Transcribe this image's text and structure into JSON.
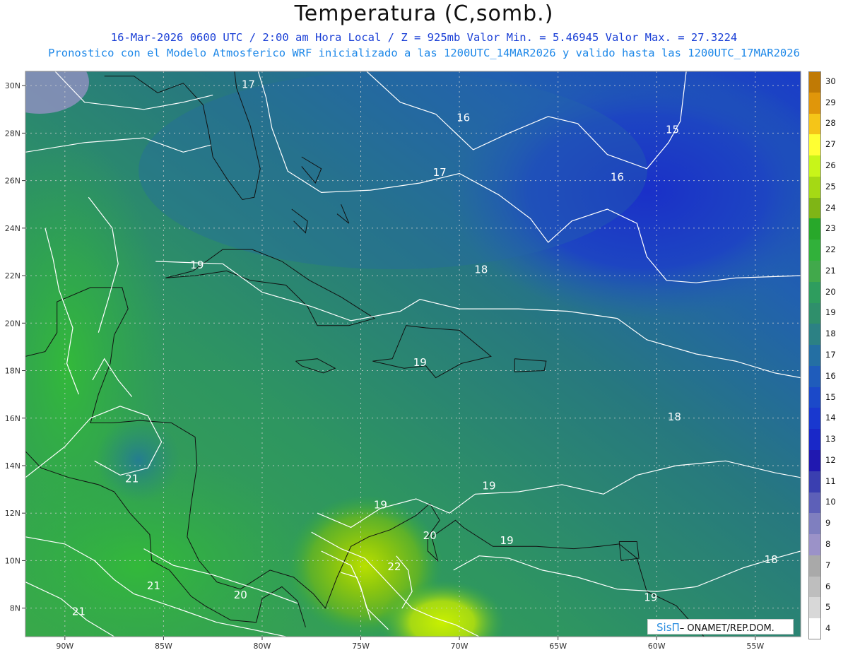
{
  "header": {
    "title": "Temperatura (C,somb.)",
    "line1": "16-Mar-2026  0600 UTC / 2:00 am Hora Local / Z = 925mb    Valor Min. = 5.46945  Valor Max. = 27.3224",
    "line2": "Pronostico con el Modelo Atmosferico WRF inicializado a las 1200UTC_14MAR2026 y valido hasta las  1200UTC_17MAR2026"
  },
  "map": {
    "lon_range": [
      -92.0,
      -52.7
    ],
    "lat_range": [
      6.8,
      30.6
    ],
    "lon_ticks": [
      {
        "value": -90,
        "label": "90W"
      },
      {
        "value": -85,
        "label": "85W"
      },
      {
        "value": -80,
        "label": "80W"
      },
      {
        "value": -75,
        "label": "75W"
      },
      {
        "value": -70,
        "label": "70W"
      },
      {
        "value": -65,
        "label": "65W"
      },
      {
        "value": -60,
        "label": "60W"
      },
      {
        "value": -55,
        "label": "55W"
      }
    ],
    "lat_ticks": [
      {
        "value": 30,
        "label": "30N"
      },
      {
        "value": 28,
        "label": "28N"
      },
      {
        "value": 26,
        "label": "26N"
      },
      {
        "value": 24,
        "label": "24N"
      },
      {
        "value": 22,
        "label": "22N"
      },
      {
        "value": 20,
        "label": "20N"
      },
      {
        "value": 18,
        "label": "18N"
      },
      {
        "value": 16,
        "label": "16N"
      },
      {
        "value": 14,
        "label": "14N"
      },
      {
        "value": 12,
        "label": "12N"
      },
      {
        "value": 10,
        "label": "10N"
      },
      {
        "value": 8,
        "label": "8N"
      }
    ],
    "contour_labels": [
      {
        "text": "17",
        "lon": -80.7,
        "lat": 29.9
      },
      {
        "text": "16",
        "lon": -69.8,
        "lat": 28.5
      },
      {
        "text": "15",
        "lon": -59.2,
        "lat": 28.0
      },
      {
        "text": "17",
        "lon": -71.0,
        "lat": 26.2
      },
      {
        "text": "16",
        "lon": -62.0,
        "lat": 26.0
      },
      {
        "text": "19",
        "lon": -83.3,
        "lat": 22.3
      },
      {
        "text": "18",
        "lon": -68.9,
        "lat": 22.1
      },
      {
        "text": "19",
        "lon": -72.0,
        "lat": 18.2
      },
      {
        "text": "18",
        "lon": -59.1,
        "lat": 15.9
      },
      {
        "text": "19",
        "lon": -68.5,
        "lat": 13.0
      },
      {
        "text": "19",
        "lon": -74.0,
        "lat": 12.2
      },
      {
        "text": "21",
        "lon": -86.6,
        "lat": 13.3
      },
      {
        "text": "20",
        "lon": -71.5,
        "lat": 10.9
      },
      {
        "text": "19",
        "lon": -67.6,
        "lat": 10.7
      },
      {
        "text": "22",
        "lon": -73.3,
        "lat": 9.6
      },
      {
        "text": "18",
        "lon": -54.2,
        "lat": 9.9
      },
      {
        "text": "21",
        "lon": -85.5,
        "lat": 8.8
      },
      {
        "text": "20",
        "lon": -81.1,
        "lat": 8.4
      },
      {
        "text": "19",
        "lon": -60.3,
        "lat": 8.3
      },
      {
        "text": "21",
        "lon": -89.3,
        "lat": 7.7
      }
    ]
  },
  "colorbar": {
    "levels": [
      30,
      29,
      28,
      27,
      26,
      25,
      24,
      23,
      22,
      21,
      20,
      19,
      18,
      17,
      16,
      15,
      14,
      13,
      12,
      11,
      10,
      9,
      8,
      7,
      6,
      5,
      4
    ],
    "colors": [
      "#c07a05",
      "#e0960a",
      "#f5c518",
      "#ffff33",
      "#c8f519",
      "#a5d914",
      "#7fb516",
      "#28a82a",
      "#31b13a",
      "#41a94b",
      "#2e9d5e",
      "#2f8f6b",
      "#2c8184",
      "#246fa3",
      "#1f5cbb",
      "#1b49c9",
      "#1938cf",
      "#1928c8",
      "#2018b0",
      "#3a3fb0",
      "#5d60b8",
      "#7f7fbf",
      "#9b92c8",
      "#a9a9a9",
      "#bebebe",
      "#d8d8d8",
      "#ffffff"
    ]
  },
  "credit": {
    "logo": "SisΠ",
    "org": "– ONAMET/REP.DOM."
  }
}
